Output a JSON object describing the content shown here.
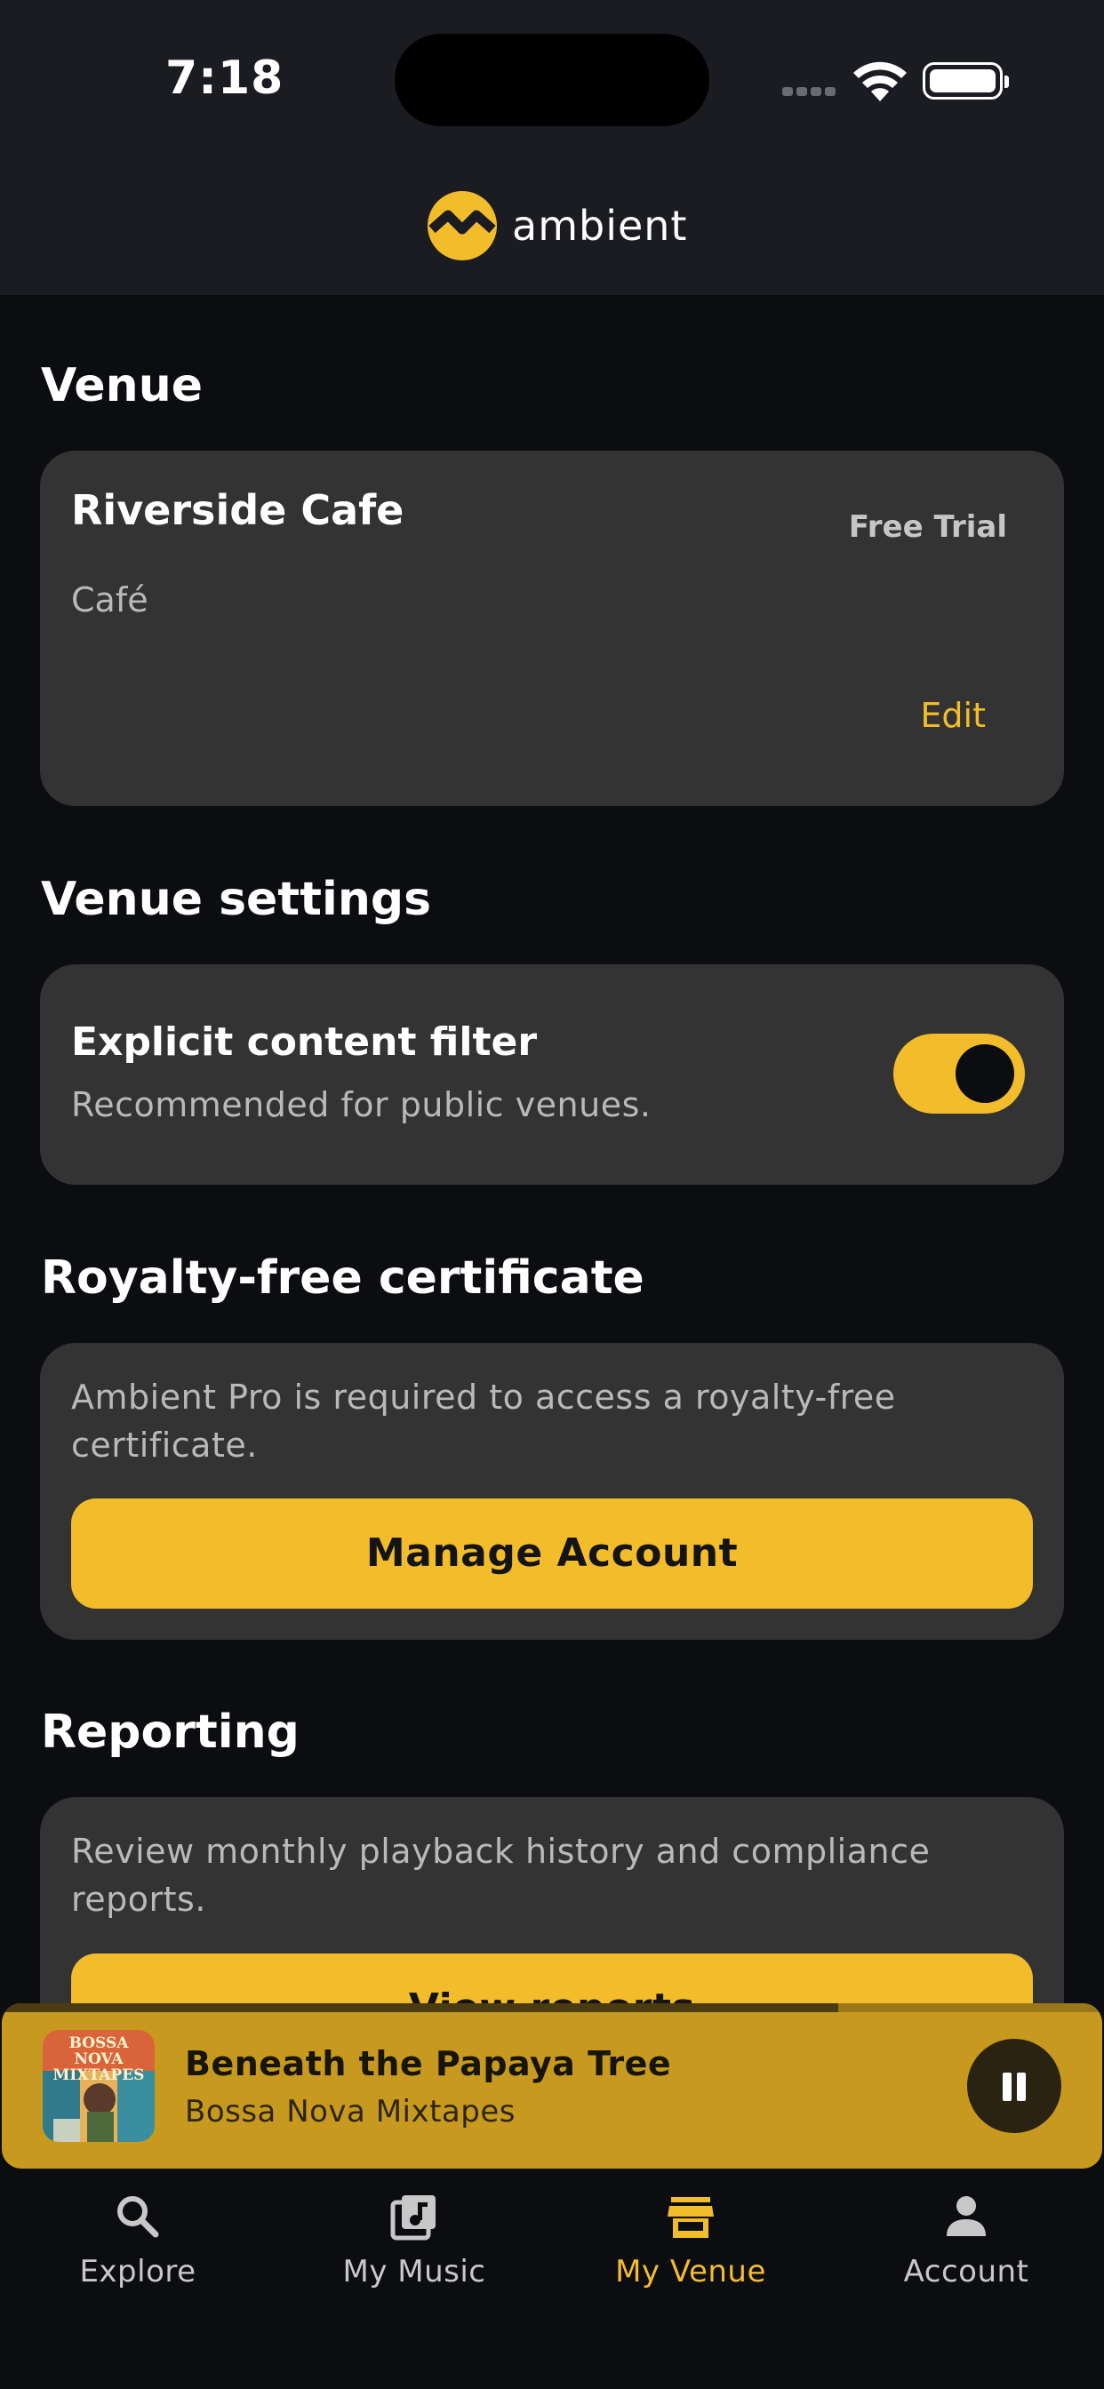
{
  "status_bar": {
    "time": "7:18"
  },
  "header": {
    "brand": "ambient",
    "accent": "#f2bc2a"
  },
  "venue": {
    "section_title": "Venue",
    "name": "Riverside Cafe",
    "plan_badge": "Free Trial",
    "type": "Café",
    "edit_label": "Edit"
  },
  "venue_settings": {
    "section_title": "Venue settings",
    "explicit_filter": {
      "title": "Explicit content filter",
      "description": "Recommended for public venues.",
      "enabled": true
    }
  },
  "certificate": {
    "section_title": "Royalty-free certificate",
    "description": "Ambient Pro is required to access a royalty-free certificate.",
    "button_label": "Manage Account"
  },
  "reporting": {
    "section_title": "Reporting",
    "description": "Review monthly playback history and compliance reports.",
    "button_label": "View reports"
  },
  "now_playing": {
    "title": "Beneath the Papaya Tree",
    "artist": "Bossa Nova Mixtapes",
    "cover_text": "BOSSA NOVA MIXTAPES",
    "progress": 0.76
  },
  "tabs": [
    {
      "label": "Explore",
      "icon": "search-icon",
      "active": false
    },
    {
      "label": "My Music",
      "icon": "music-library-icon",
      "active": false
    },
    {
      "label": "My Venue",
      "icon": "store-icon",
      "active": true
    },
    {
      "label": "Account",
      "icon": "person-icon",
      "active": false
    }
  ]
}
